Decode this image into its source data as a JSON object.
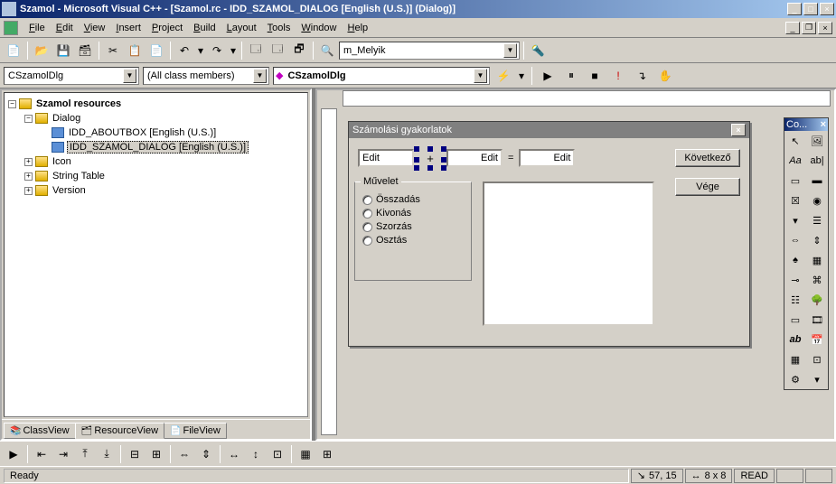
{
  "window": {
    "title": "Szamol - Microsoft Visual C++ - [Szamol.rc - IDD_SZAMOL_DIALOG [English (U.S.)] (Dialog)]"
  },
  "menu": {
    "file": "File",
    "edit": "Edit",
    "view": "View",
    "insert": "Insert",
    "project": "Project",
    "build": "Build",
    "layout": "Layout",
    "tools": "Tools",
    "window": "Window",
    "help": "Help"
  },
  "toolbar1": {
    "find_combo": "m_Melyik"
  },
  "toolbar2": {
    "class_combo": "CSzamolDlg",
    "filter_combo": "(All class members)",
    "member_combo": "CSzamolDlg"
  },
  "tree": {
    "root": "Szamol resources",
    "dialog": "Dialog",
    "aboutbox": "IDD_ABOUTBOX [English (U.S.)]",
    "szamol_dialog": "IDD_SZAMOL_DIALOG [English (U.S.)]",
    "icon": "Icon",
    "string_table": "String Table",
    "version": "Version"
  },
  "tabs": {
    "class": "ClassView",
    "resource": "ResourceView",
    "file": "FileView"
  },
  "dialog": {
    "title": "Számolási gyakorlatok",
    "edit1": "Edit",
    "plus": "+",
    "edit2": "Edit",
    "equals": "=",
    "edit3": "Edit",
    "next_btn": "Következő",
    "end_btn": "Vége",
    "group": "Művelet",
    "op1": "Összadás",
    "op2": "Kivonás",
    "op3": "Szorzás",
    "op4": "Osztás"
  },
  "toolbox": {
    "title": "Co..."
  },
  "status": {
    "ready": "Ready",
    "pos_icon": "↘",
    "pos": "57, 15",
    "size_icon": "↔",
    "size": "8 x 8",
    "read": "READ"
  }
}
